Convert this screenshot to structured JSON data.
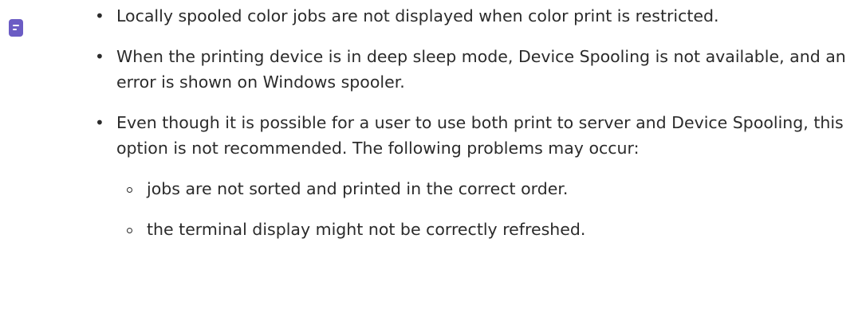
{
  "note": {
    "icon": "note-icon",
    "icon_color": "#6b5cc4",
    "bullets": [
      {
        "text": "Locally spooled color jobs are not displayed when color print is restricted."
      },
      {
        "text": "When the printing device is in deep sleep mode, Device Spooling is not available, and an error is shown on Windows spooler."
      },
      {
        "text": "Even though it is possible for a user to use both print to server and Device Spooling, this option is not recommended. The following problems may occur:"
      }
    ],
    "sub_bullets": [
      {
        "text": "jobs are not sorted and printed in the correct order."
      },
      {
        "text": "the terminal display might not be correctly refreshed."
      }
    ]
  }
}
